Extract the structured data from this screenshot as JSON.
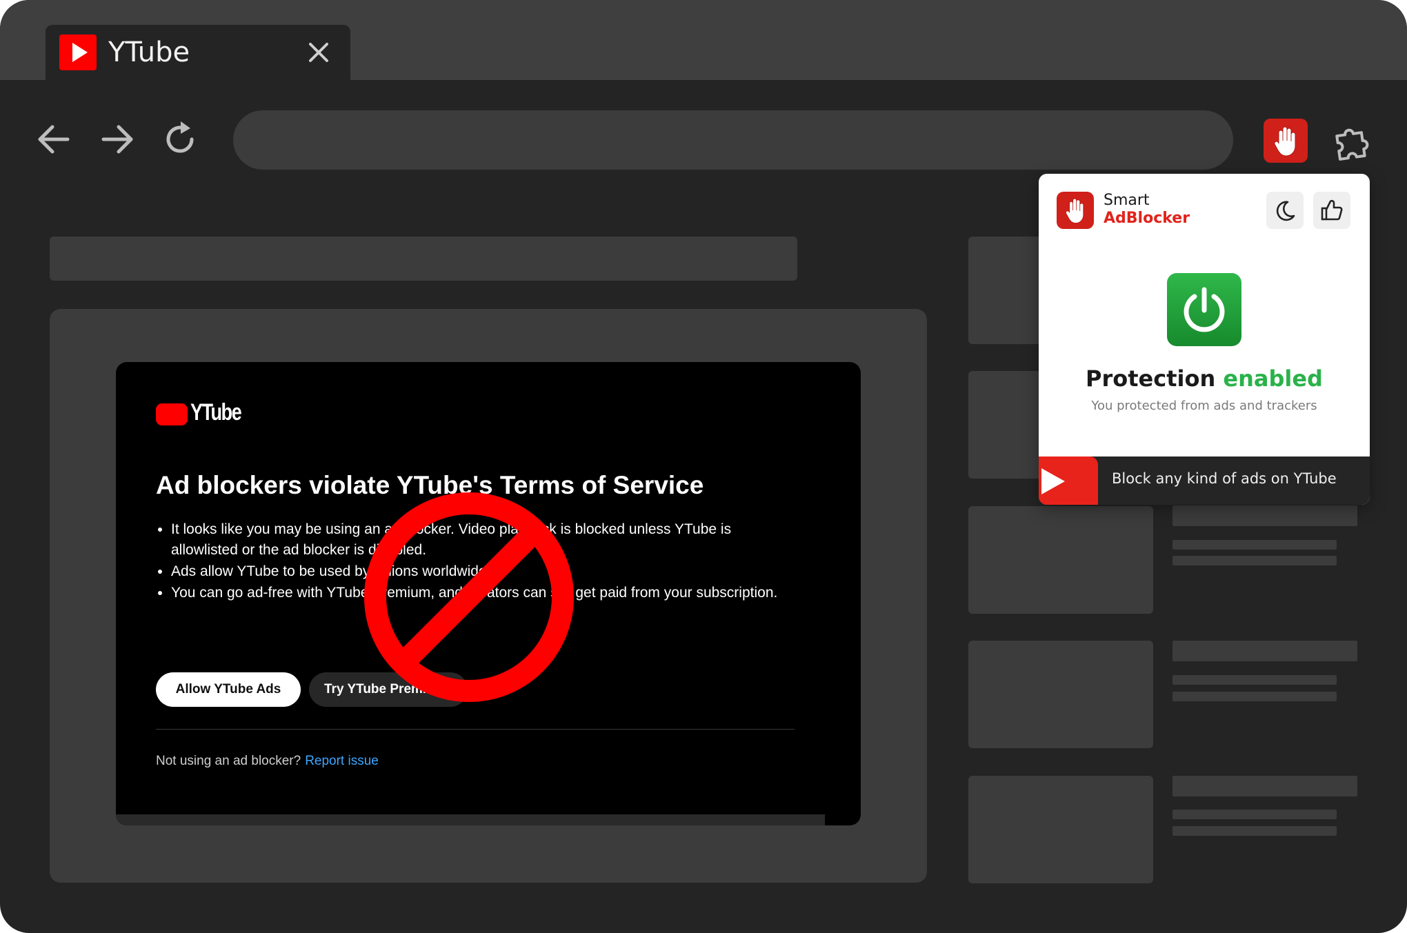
{
  "tab": {
    "title": "YTube"
  },
  "dialog": {
    "logo_text": "YTube",
    "title": "Ad blockers violate YTube's Terms of Service",
    "bullets": [
      "It looks like you may be using an ad blocker. Video playback is blocked unless YTube is allowlisted or the ad blocker is disabled.",
      "Ads allow YTube to be used by billions worldwide.",
      "You can go ad-free with YTube Premium, and creators can still get paid from your subscription."
    ],
    "allow_button": "Allow YTube Ads",
    "premium_button": "Try YTube Premium",
    "footer_text": "Not using an ad blocker?",
    "report_link": "Report issue"
  },
  "popup": {
    "brand_line1": "Smart",
    "brand_line2": "AdBlocker",
    "status_title": "Protection",
    "status_accent": "enabled",
    "status_subtitle": "You protected from ads and trackers",
    "promo_text": "Block any kind of ads on YTube"
  },
  "colors": {
    "brand_red": "#d0201a",
    "enabled_green": "#2ab24a",
    "link_blue": "#3ea6ff"
  }
}
